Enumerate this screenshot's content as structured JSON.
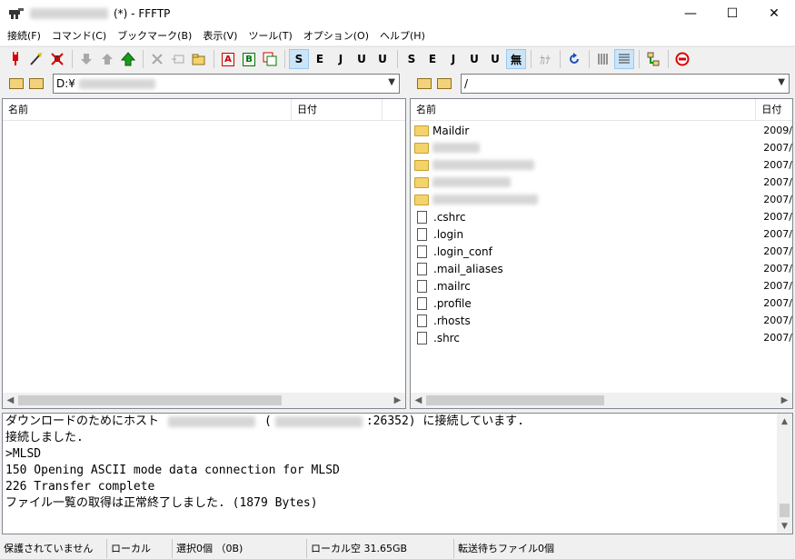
{
  "window": {
    "title_suffix": "(*) - FFFTP",
    "minimize": "—",
    "maximize": "☐",
    "close": "✕"
  },
  "menu": [
    "接続(F)",
    "コマンド(C)",
    "ブックマーク(B)",
    "表示(V)",
    "ツール(T)",
    "オプション(O)",
    "ヘルプ(H)"
  ],
  "toolbar": {
    "kanji": {
      "sjis": "S",
      "euc": "E",
      "jis": "J",
      "utf8n": "U",
      "utf8bom": "U",
      "none": "無"
    },
    "kana": "ｶﾅ",
    "ascii_a": "A",
    "binary_b": "B"
  },
  "local": {
    "path": "D:¥",
    "columns": {
      "name": "名前",
      "date": "日付"
    },
    "files": []
  },
  "remote": {
    "path": "/",
    "columns": {
      "name": "名前",
      "date": "日付"
    },
    "files": [
      {
        "name": "Maildir",
        "type": "folder",
        "date": "2009/"
      },
      {
        "name": "",
        "type": "folder",
        "date": "2007/",
        "blurred": true
      },
      {
        "name": "",
        "type": "folder",
        "date": "2007/",
        "blurred": true
      },
      {
        "name": "",
        "type": "folder",
        "date": "2007/",
        "blurred": true
      },
      {
        "name": "",
        "type": "folder",
        "date": "2007/",
        "blurred": true
      },
      {
        "name": ".cshrc",
        "type": "file",
        "date": "2007/"
      },
      {
        "name": ".login",
        "type": "file",
        "date": "2007/"
      },
      {
        "name": ".login_conf",
        "type": "file",
        "date": "2007/"
      },
      {
        "name": ".mail_aliases",
        "type": "file",
        "date": "2007/"
      },
      {
        "name": ".mailrc",
        "type": "file",
        "date": "2007/"
      },
      {
        "name": ".profile",
        "type": "file",
        "date": "2007/"
      },
      {
        "name": ".rhosts",
        "type": "file",
        "date": "2007/"
      },
      {
        "name": ".shrc",
        "type": "file",
        "date": "2007/"
      }
    ]
  },
  "log": {
    "line1_a": "ダウンロードのためにホスト",
    "line1_b": "(",
    "line1_c": ":26352) に接続しています.",
    "lines": [
      "接続しました.",
      ">MLSD",
      "150 Opening ASCII mode data connection for MLSD",
      "226 Transfer complete",
      "ファイル一覧の取得は正常終了しました. (1879 Bytes)"
    ]
  },
  "status": {
    "protect": "保護されていません",
    "local": "ローカル",
    "selection": "選択0個 （0B)",
    "free": "ローカル空 31.65GB",
    "queue": "転送待ちファイル0個"
  }
}
